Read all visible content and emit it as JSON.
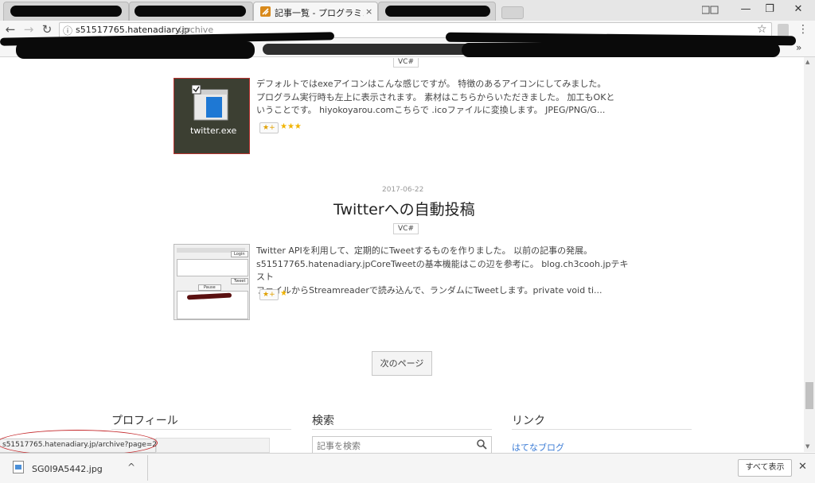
{
  "browser": {
    "active_tab_title": "記事一覧 - プログラミング未",
    "url_host": "s51517765.hatenadiary.jp",
    "url_path": "/archive",
    "tab_close_glyph": "×",
    "window_controls": {
      "minimize": "—",
      "restore": "❐",
      "close": "✕"
    },
    "nav_glyphs": {
      "back": "←",
      "forward": "→",
      "reload": "↻",
      "info": "ⓘ",
      "star": "☆",
      "menu": "⋮",
      "more": "»"
    }
  },
  "posts": [
    {
      "tag": "VC#",
      "thumbnail_caption": "twitter.exe",
      "excerpt_lines": [
        "デフォルトではexeアイコンはこんな感じですが。 特徴のあるアイコンにしてみました。",
        "プログラム実行時も左上に表示されます。 素材はこちらからいただきました。 加工もOKと",
        "いうことです。 hiyokoyarou.comこちらで .icoファイルに変換します。 JPEG/PNG/G..."
      ],
      "star_button": "★+",
      "stars": "★★★"
    },
    {
      "date": "2017-06-22",
      "title": "Twitterへの自動投稿",
      "tag": "VC#",
      "excerpt_lines": [
        "Twitter APIを利用して、定期的にTweetするものを作りました。 以前の記事の発展。",
        "s51517765.hatenadiary.jpCoreTweetの基本機能はこの辺を参考に。 blog.ch3cooh.jpテキスト",
        "ファイルからStreamreaderで読み込んで、ランダムにTweetします。private void ti..."
      ],
      "star_button": "★+",
      "stars": "★",
      "thumbnail_labels": {
        "login": "Login",
        "tweet": "Tweet",
        "pause": "Pause"
      }
    }
  ],
  "pagination": {
    "next_label": "次のページ"
  },
  "sidebar": {
    "profile_heading": "プロフィール",
    "search_heading": "検索",
    "search_placeholder": "記事を検索",
    "links_heading": "リンク",
    "links": [
      "はてなブログ"
    ]
  },
  "status_bar": {
    "url": "s51517765.hatenadiary.jp/archive?page=2"
  },
  "download_shelf": {
    "file_name": "SG0I9A5442.jpg",
    "chevron": "^",
    "show_all_label": "すべて表示",
    "close_glyph": "✕"
  },
  "colors": {
    "accent_link": "#3a7bd5",
    "annotation_red": "#c4272a",
    "star_gold": "#f1b400"
  }
}
